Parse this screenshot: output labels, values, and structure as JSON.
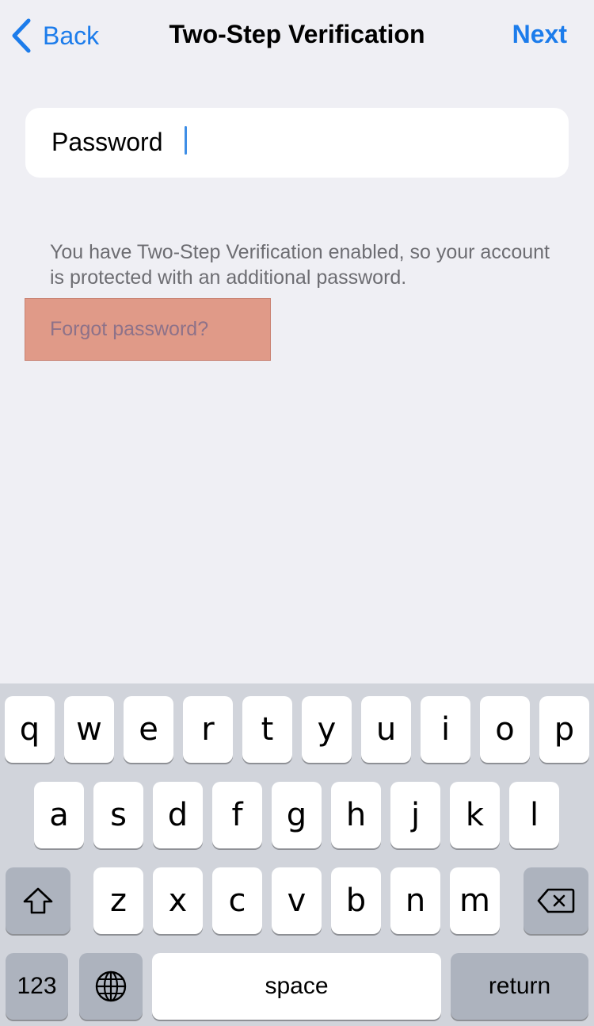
{
  "navbar": {
    "back_label": "Back",
    "title": "Two-Step Verification",
    "next_label": "Next",
    "accent_color": "#1C7CEB"
  },
  "password_field": {
    "label": "Password",
    "value": "",
    "placeholder": ""
  },
  "info_text": "You have Two-Step Verification enabled, so your account is protected with an additional password.",
  "forgot_link": {
    "label": "Forgot password?",
    "highlight_color": "#E09A88"
  },
  "keyboard": {
    "row1": [
      "q",
      "w",
      "e",
      "r",
      "t",
      "y",
      "u",
      "i",
      "o",
      "p"
    ],
    "row2": [
      "a",
      "s",
      "d",
      "f",
      "g",
      "h",
      "j",
      "k",
      "l"
    ],
    "row3": [
      "z",
      "x",
      "c",
      "v",
      "b",
      "n",
      "m"
    ],
    "shift_icon": "shift-arrow-icon",
    "delete_icon": "backspace-icon",
    "numbers_label": "123",
    "globe_icon": "globe-icon",
    "space_label": "space",
    "return_label": "return"
  }
}
